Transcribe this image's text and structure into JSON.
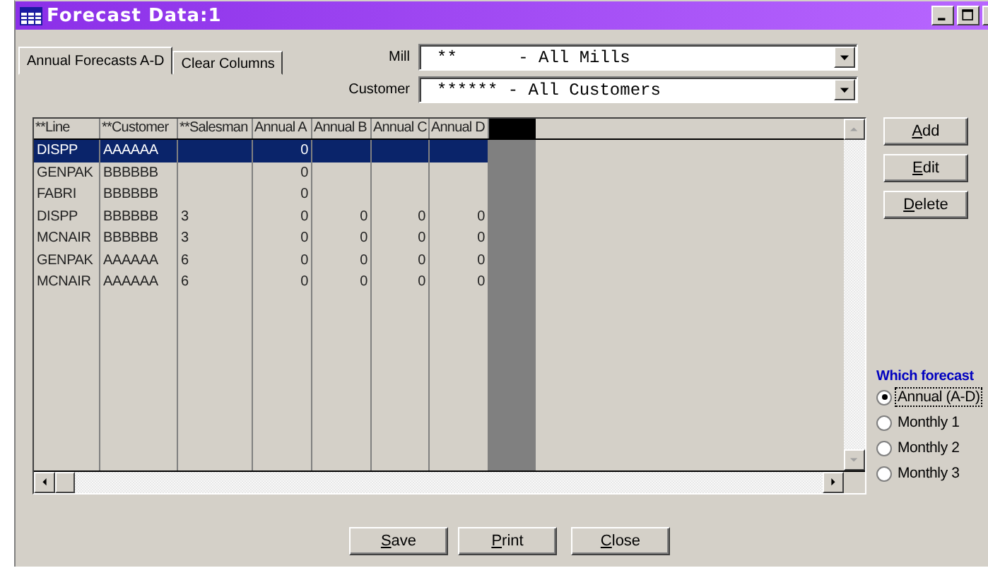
{
  "window": {
    "title": "Forecast Data:1"
  },
  "filters": [
    {
      "label": "Mill",
      "value": "**      - All Mills"
    },
    {
      "label": "Customer",
      "value": "****** - All Customers"
    }
  ],
  "tabs": [
    {
      "label": "Annual Forecasts A-D",
      "selected": true
    },
    {
      "label": "Clear Columns",
      "selected": false
    }
  ],
  "table": {
    "columns": [
      "**Line",
      "**Customer",
      "**Salesman",
      "Annual A",
      "Annual B",
      "Annual C",
      "Annual D"
    ],
    "rows": [
      {
        "selected": true,
        "cells": [
          "DISPP",
          "AAAAAA",
          null,
          "0",
          null,
          null,
          null
        ]
      },
      {
        "selected": false,
        "cells": [
          "GENPAK",
          "BBBBBB",
          null,
          "0",
          null,
          null,
          null
        ]
      },
      {
        "selected": false,
        "cells": [
          "FABRI",
          "BBBBBB",
          null,
          "0",
          null,
          null,
          null
        ]
      },
      {
        "selected": false,
        "cells": [
          "DISPP",
          "BBBBBB",
          "3",
          "0",
          "0",
          "0",
          "0"
        ]
      },
      {
        "selected": false,
        "cells": [
          "MCNAIR",
          "BBBBBB",
          "3",
          "0",
          "0",
          "0",
          "0"
        ]
      },
      {
        "selected": false,
        "cells": [
          "GENPAK",
          "AAAAAA",
          "6",
          "0",
          "0",
          "0",
          "0"
        ]
      },
      {
        "selected": false,
        "cells": [
          "MCNAIR",
          "AAAAAA",
          "6",
          "0",
          "0",
          "0",
          "0"
        ]
      }
    ]
  },
  "side_buttons": [
    "Add",
    "Edit",
    "Delete"
  ],
  "forecast_choice": {
    "title": "Which forecast",
    "options": [
      {
        "label": "Annual (A-D)",
        "selected": true
      },
      {
        "label": "Monthly 1",
        "selected": false
      },
      {
        "label": "Monthly 2",
        "selected": false
      },
      {
        "label": "Monthly 3",
        "selected": false
      }
    ]
  },
  "bottom_buttons": [
    "Save",
    "Print",
    "Close"
  ]
}
